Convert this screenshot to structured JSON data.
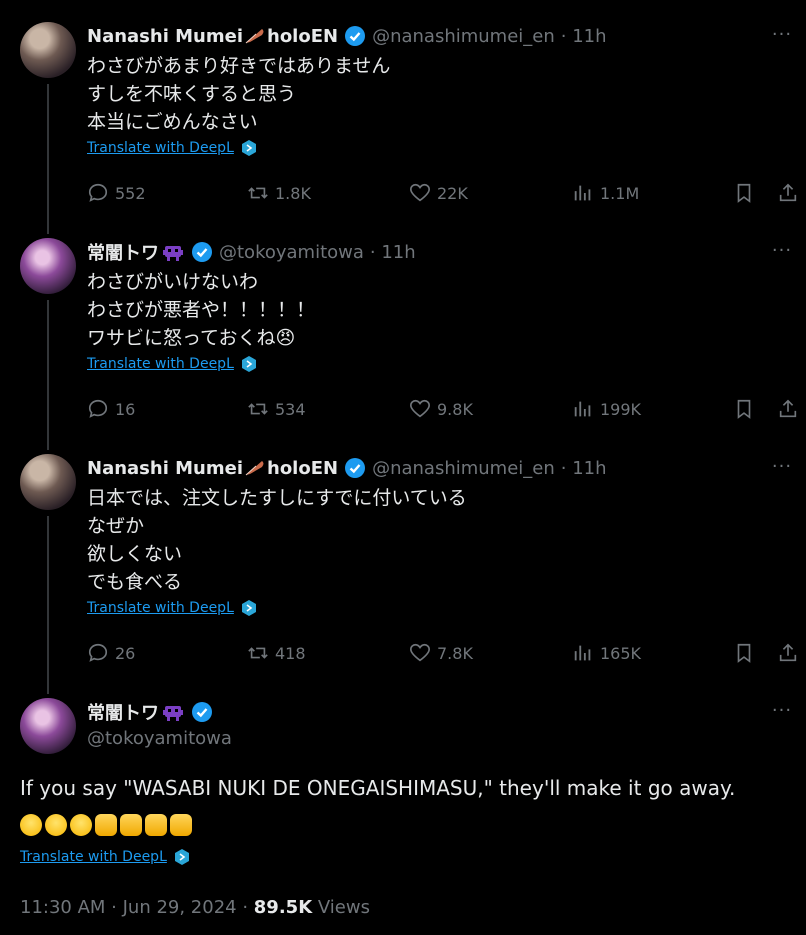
{
  "posts": [
    {
      "name": "Nanashi Mumei",
      "name_suffix": "holoEN",
      "handle": "@nanashimumei_en",
      "time": "· 11h",
      "lines": [
        "わさびがあまり好きではありません",
        "すしを不味くすると思う",
        "本当にごめんなさい"
      ],
      "translate": "Translate with DeepL",
      "replies": "552",
      "reposts": "1.8K",
      "likes": "22K",
      "views": "1.1M"
    },
    {
      "name": "常闇トワ",
      "handle": "@tokoyamitowa",
      "time": "· 11h",
      "lines": [
        "わさびがいけないわ",
        "わさびが悪者や！！！！！",
        "ワサビに怒っておくね😠"
      ],
      "translate": "Translate with DeepL",
      "replies": "16",
      "reposts": "534",
      "likes": "9.8K",
      "views": "199K"
    },
    {
      "name": "Nanashi Mumei",
      "name_suffix": "holoEN",
      "handle": "@nanashimumei_en",
      "time": "· 11h",
      "lines": [
        "日本では、注文したすしにすでに付いている",
        "なぜか",
        "欲しくない",
        "でも食べる"
      ],
      "translate": "Translate with DeepL",
      "replies": "26",
      "reposts": "418",
      "likes": "7.8K",
      "views": "165K"
    }
  ],
  "main_post": {
    "name": "常闇トワ",
    "handle": "@tokoyamitowa",
    "text": "If you say \"WASABI NUKI DE ONEGAISHIMASU,\" they'll make it go away.",
    "emojis": [
      "laughing",
      "laughing",
      "laughing",
      "thumbs-up",
      "thumbs-up",
      "thumbs-up",
      "thumbs-up"
    ],
    "translate": "Translate with DeepL",
    "timestamp": "11:30 AM · Jun 29, 2024 · ",
    "views_count": "89.5K",
    "views_label": " Views"
  },
  "colors": {
    "accent": "#1d9bf0",
    "muted": "#71767b",
    "text": "#e7e9ea",
    "background": "#000000"
  }
}
